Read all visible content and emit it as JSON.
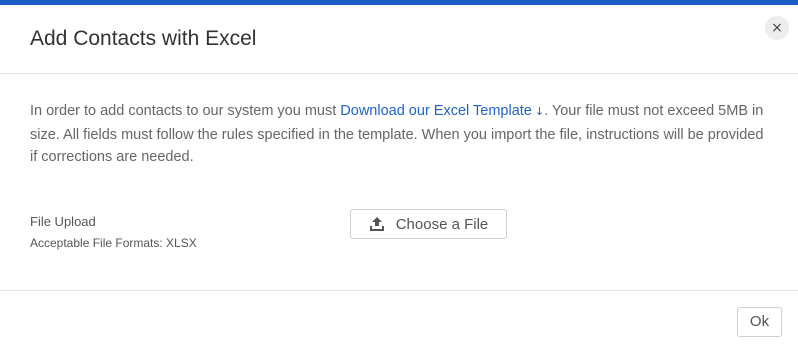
{
  "dialog": {
    "title": "Add Contacts with Excel",
    "close_glyph": "×",
    "accent_color": "#1b5bc4",
    "link_color": "#1f63c6"
  },
  "body": {
    "intro_before_link": "In order to add contacts to our system you must ",
    "template_link": "Download our Excel Template",
    "download_glyph": "↓",
    "intro_after_link": ". Your file must not exceed 5MB in size. All fields must follow the rules specified in the template. When you import the file, instructions will be provided if corrections are needed.",
    "upload": {
      "label": "File Upload",
      "formats": "Acceptable File Formats: XLSX",
      "button_label": "Choose a File",
      "button_icon": "upload-icon"
    }
  },
  "footer": {
    "ok_label": "Ok"
  }
}
